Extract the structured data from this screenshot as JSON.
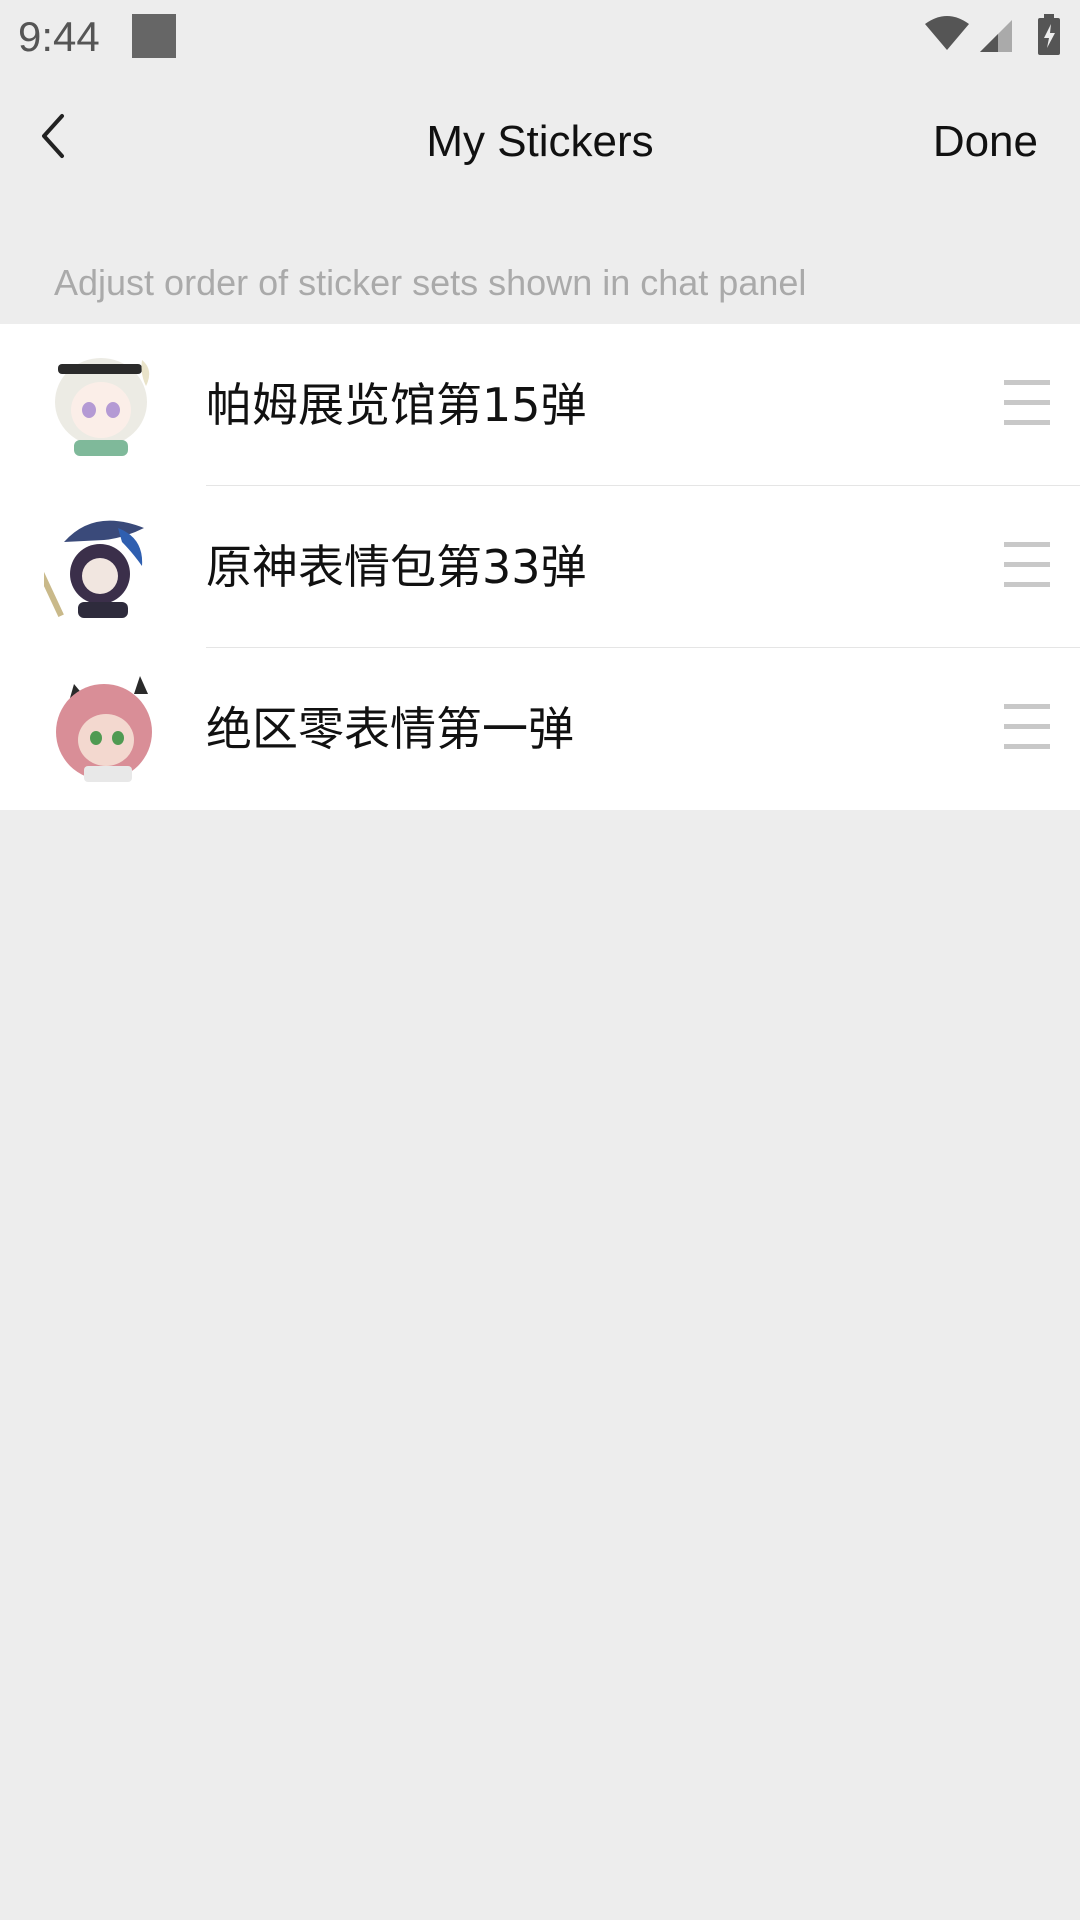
{
  "status_bar": {
    "time": "9:44",
    "icons": [
      "app-notification-icon",
      "wifi-icon",
      "signal-icon",
      "battery-charging-icon"
    ]
  },
  "nav": {
    "back_icon": "chevron-left-icon",
    "title": "My Stickers",
    "done_label": "Done"
  },
  "hint": "Adjust order of sticker sets shown in chat panel",
  "sticker_sets": [
    {
      "name": "帕姆展览馆第15弹",
      "thumb": "sticker-thumb-white-hair-girl"
    },
    {
      "name": "原神表情包第33弹",
      "thumb": "sticker-thumb-dark-hair-hat"
    },
    {
      "name": "绝区零表情第一弹",
      "thumb": "sticker-thumb-pink-hair-girl"
    }
  ],
  "drag_icon": "drag-handle-icon",
  "colors": {
    "background": "#ededed",
    "list_background": "#ffffff",
    "hint_text": "#aaaaaa",
    "primary_text": "#111111",
    "drag_handle": "#c8c8c8"
  }
}
